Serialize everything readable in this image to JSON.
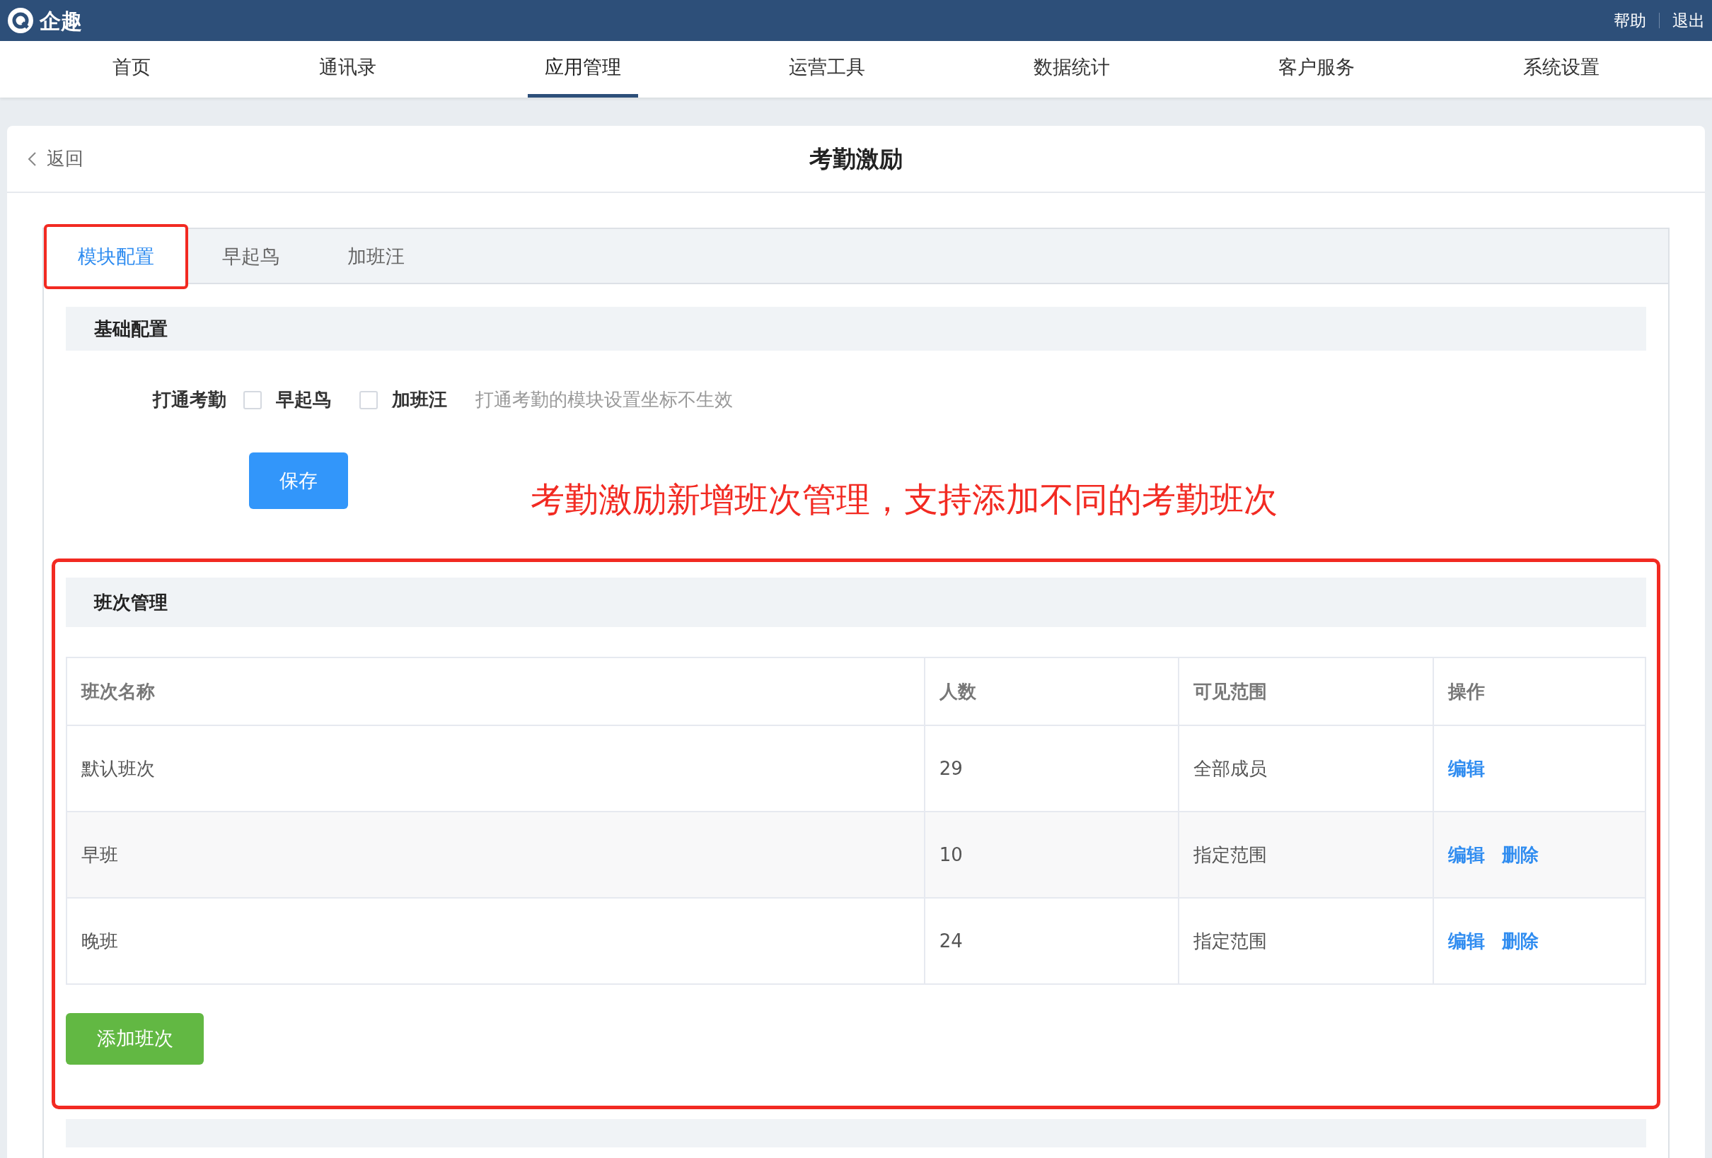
{
  "topbar": {
    "brand": "企趣",
    "links": [
      "帮助",
      "退出"
    ]
  },
  "nav": [
    {
      "label": "首页",
      "selected": false
    },
    {
      "label": "通讯录",
      "selected": false
    },
    {
      "label": "应用管理",
      "selected": true
    },
    {
      "label": "运营工具",
      "selected": false
    },
    {
      "label": "数据统计",
      "selected": false
    },
    {
      "label": "客户服务",
      "selected": false
    },
    {
      "label": "系统设置",
      "selected": false
    }
  ],
  "page": {
    "back": "返回",
    "title": "考勤激励"
  },
  "tabs": [
    {
      "label": "模块配置",
      "selected": true,
      "highlighted": true
    },
    {
      "label": "早起鸟",
      "selected": false,
      "highlighted": false
    },
    {
      "label": "加班汪",
      "selected": false,
      "highlighted": false
    }
  ],
  "basic": {
    "heading": "基础配置",
    "field_label": "打通考勤",
    "options": [
      {
        "label": "早起鸟",
        "checked": false
      },
      {
        "label": "加班汪",
        "checked": false
      }
    ],
    "hint": "打通考勤的模块设置坐标不生效",
    "save": "保存"
  },
  "annotation": "考勤激励新增班次管理，支持添加不同的考勤班次",
  "shifts": {
    "heading": "班次管理",
    "columns": [
      "班次名称",
      "人数",
      "可见范围",
      "操作"
    ],
    "rows": [
      {
        "name": "默认班次",
        "count": "29",
        "scope": "全部成员",
        "actions": [
          "编辑"
        ]
      },
      {
        "name": "早班",
        "count": "10",
        "scope": "指定范围",
        "actions": [
          "编辑",
          "删除"
        ]
      },
      {
        "name": "晚班",
        "count": "24",
        "scope": "指定范围",
        "actions": [
          "编辑",
          "删除"
        ]
      }
    ],
    "add": "添加班次"
  }
}
